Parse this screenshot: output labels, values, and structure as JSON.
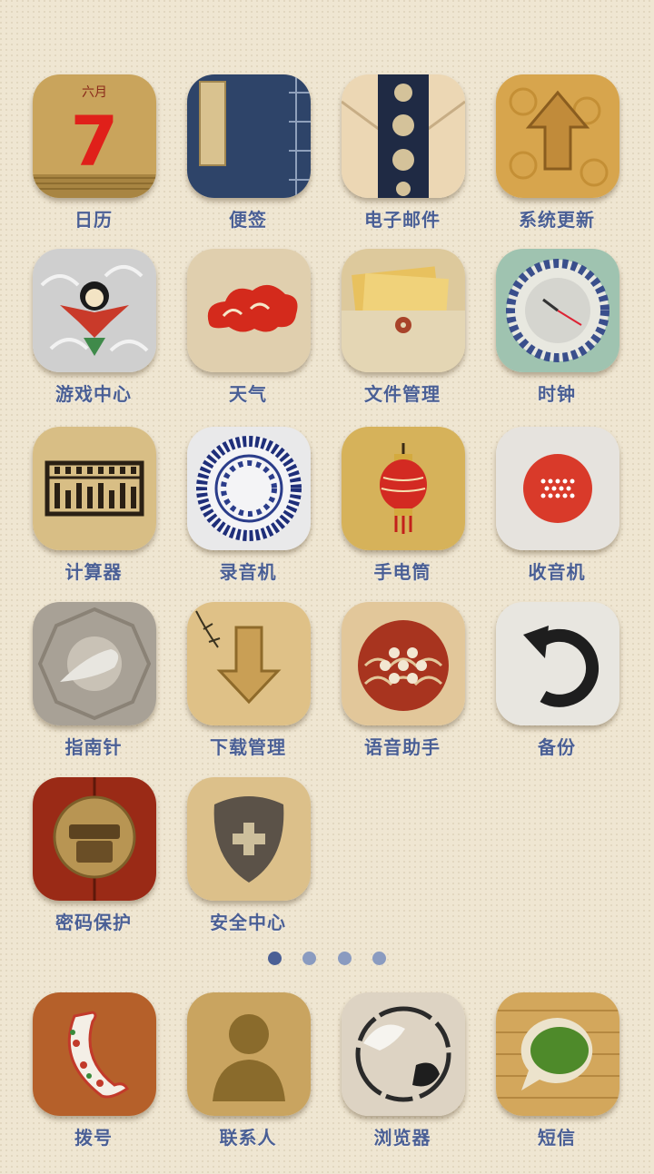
{
  "calendar_icon": {
    "month": "六月",
    "day": "7"
  },
  "apps": [
    {
      "label": "日历",
      "icon": "calendar-icon"
    },
    {
      "label": "便签",
      "icon": "notebook-icon"
    },
    {
      "label": "电子邮件",
      "icon": "envelope-icon"
    },
    {
      "label": "系统更新",
      "icon": "upload-arrow-icon"
    },
    {
      "label": "游戏中心",
      "icon": "kite-icon"
    },
    {
      "label": "天气",
      "icon": "cloud-icon"
    },
    {
      "label": "文件管理",
      "icon": "folder-icon"
    },
    {
      "label": "时钟",
      "icon": "clock-icon"
    },
    {
      "label": "计算器",
      "icon": "abacus-icon"
    },
    {
      "label": "录音机",
      "icon": "porcelain-plate-icon"
    },
    {
      "label": "手电筒",
      "icon": "lantern-icon"
    },
    {
      "label": "收音机",
      "icon": "radio-speaker-icon"
    },
    {
      "label": "指南针",
      "icon": "compass-icon"
    },
    {
      "label": "下载管理",
      "icon": "download-arrow-icon"
    },
    {
      "label": "语音助手",
      "icon": "microphone-pattern-icon"
    },
    {
      "label": "备份",
      "icon": "rotate-arrow-icon"
    },
    {
      "label": "密码保护",
      "icon": "lock-icon"
    },
    {
      "label": "安全中心",
      "icon": "shield-icon"
    }
  ],
  "page_indicator": {
    "count": 4,
    "active": 1
  },
  "dock": [
    {
      "label": "拨号",
      "icon": "phone-icon"
    },
    {
      "label": "联系人",
      "icon": "contact-silhouette-icon"
    },
    {
      "label": "浏览器",
      "icon": "ink-circle-icon"
    },
    {
      "label": "短信",
      "icon": "message-bubble-icon"
    }
  ]
}
